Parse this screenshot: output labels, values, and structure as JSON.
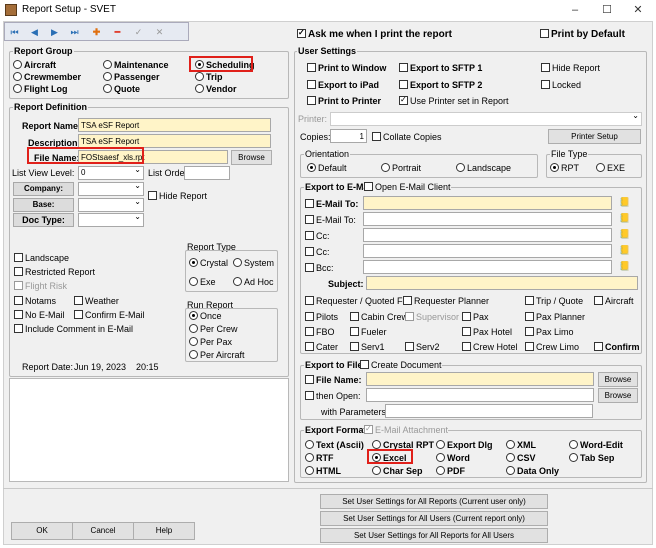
{
  "window": {
    "title": "Report Setup - SVET",
    "min": "–",
    "max": "☐",
    "close": "✕"
  },
  "toolbar": [
    "first-icon",
    "prev-icon",
    "next-icon",
    "last-icon",
    "add-icon",
    "delete-icon",
    "save-icon",
    "cancel-icon"
  ],
  "ask_print": "Ask me when I print the report",
  "print_default": "Print by Default",
  "report_group": {
    "title": "Report Group",
    "options": [
      {
        "label": "Aircraft",
        "checked": false
      },
      {
        "label": "Maintenance",
        "checked": false
      },
      {
        "label": "Scheduling",
        "checked": true
      },
      {
        "label": "Crewmember",
        "checked": false
      },
      {
        "label": "Passenger",
        "checked": false
      },
      {
        "label": "Trip",
        "checked": false
      },
      {
        "label": "Flight Log",
        "checked": false
      },
      {
        "label": "Quote",
        "checked": false
      },
      {
        "label": "Vendor",
        "checked": false
      }
    ]
  },
  "report_def": {
    "title": "Report Definition",
    "name_label": "Report Name:",
    "name": "TSA eSF Report",
    "desc_label": "Description:",
    "desc": "TSA eSF Report",
    "file_label": "File Name:",
    "file": "FOStsaesf_xls.rpt",
    "browse": "Browse",
    "view_level_label": "List View Level:",
    "view_level": "0",
    "list_order_label": "List Order:",
    "company": "Company:",
    "base": "Base:",
    "doc_type": "Doc Type:",
    "hide_report": "Hide Report"
  },
  "options": {
    "landscape": "Landscape",
    "restricted": "Restricted Report",
    "flight_risk": "Flight Risk",
    "notams": "Notams",
    "weather": "Weather",
    "no_email": "No E-Mail",
    "confirm_email": "Confirm E-Mail",
    "include_comment": "Include Comment in E-Mail"
  },
  "report_type": {
    "title": "Report Type",
    "crystal": "Crystal",
    "system": "System",
    "exe": "Exe",
    "adhoc": "Ad Hoc"
  },
  "run_report": {
    "title": "Run Report",
    "once": "Once",
    "per_crew": "Per Crew",
    "per_pax": "Per Pax",
    "per_aircraft": "Per Aircraft"
  },
  "report_date": {
    "label": "Report Date:",
    "date": "Jun 19, 2023",
    "time": "20:15"
  },
  "user_settings": {
    "title": "User Settings",
    "print_window": "Print to Window",
    "export_sftp1": "Export to SFTP 1",
    "hide_report": "Hide Report",
    "export_ipad": "Export to iPad",
    "export_sftp2": "Export to SFTP 2",
    "locked": "Locked",
    "print_printer": "Print to Printer",
    "use_printer_set": "Use Printer set in Report"
  },
  "printer": {
    "label": "Printer:",
    "copies_label": "Copies:",
    "copies": "1",
    "collate": "Collate Copies",
    "setup": "Printer Setup"
  },
  "orientation": {
    "title": "Orientation",
    "default": "Default",
    "portrait": "Portrait",
    "landscape": "Landscape"
  },
  "file_type": {
    "title": "File Type",
    "rpt": "RPT",
    "exe": "EXE"
  },
  "email": {
    "title": "Export to E-Mail",
    "open_client": "Open E-Mail Client",
    "email_to1": "E-Mail To:",
    "email_to2": "E-Mail To:",
    "cc1": "Cc:",
    "cc2": "Cc:",
    "bcc": "Bcc:",
    "subject": "Subject:"
  },
  "recipients": [
    "Requester / Quoted For",
    "Requester Planner",
    "Trip / Quote",
    "Aircraft",
    "Pilots",
    "Cabin Crew",
    "Supervisor",
    "Pax",
    "Pax Planner",
    "FBO",
    "Fueler",
    "Pax Hotel",
    "Pax Limo",
    "Cater",
    "Serv1",
    "Serv2",
    "Crew Hotel",
    "Crew Limo",
    "Confirm"
  ],
  "export_file": {
    "title": "Export to File",
    "create_doc": "Create Document",
    "file_name": "File Name:",
    "then_open": "then Open:",
    "with_params": "with Parameters:",
    "browse": "Browse"
  },
  "export_format": {
    "title": "Export Format",
    "email_attachment": "E-Mail Attachment",
    "options": [
      "Text (Ascii)",
      "Crystal RPT",
      "Export Dlg",
      "XML",
      "Word-Edit",
      "RTF",
      "Excel",
      "Word",
      "CSV",
      "Tab Sep",
      "HTML",
      "Char Sep",
      "PDF",
      "Data Only"
    ],
    "selected": "Excel"
  },
  "footer": {
    "ok": "OK",
    "cancel": "Cancel",
    "help": "Help",
    "set1": "Set User Settings for All Reports (Current user only)",
    "set2": "Set User Settings for All Users (Current report only)",
    "set3": "Set User Settings for All Reports for All Users"
  }
}
